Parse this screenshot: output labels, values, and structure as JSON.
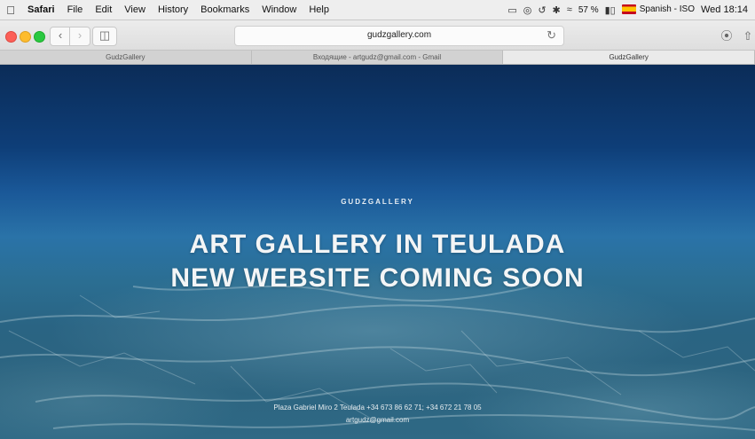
{
  "menubar": {
    "app_name": "Safari",
    "items": [
      "File",
      "Edit",
      "View",
      "History",
      "Bookmarks",
      "Window",
      "Help"
    ],
    "battery": "57 %",
    "input_source": "Spanish - ISO",
    "clock": "Wed 18:14"
  },
  "toolbar": {
    "url": "gudzgallery.com"
  },
  "tabs": [
    {
      "title": "GudzGallery",
      "active": false
    },
    {
      "title": "Входящие - artgudz@gmail.com - Gmail",
      "active": false
    },
    {
      "title": "GudzGallery",
      "active": true
    }
  ],
  "page": {
    "kicker": "GUDZGALLERY",
    "headline_line1": "ART GALLERY IN TEULADA",
    "headline_line2": "NEW WEBSITE COMING SOON",
    "footer_address": "Plaza Gabriel Miro 2 Teulada +34 673 86 62 71; +34 672 21 78 05",
    "footer_email": "artgudz@gmail.com"
  },
  "colors": {
    "close": "#fc5f57",
    "minimize": "#fdbc2e",
    "maximize": "#29c840",
    "hero_top": "#0b2c58",
    "hero_bottom": "#2f6985"
  }
}
